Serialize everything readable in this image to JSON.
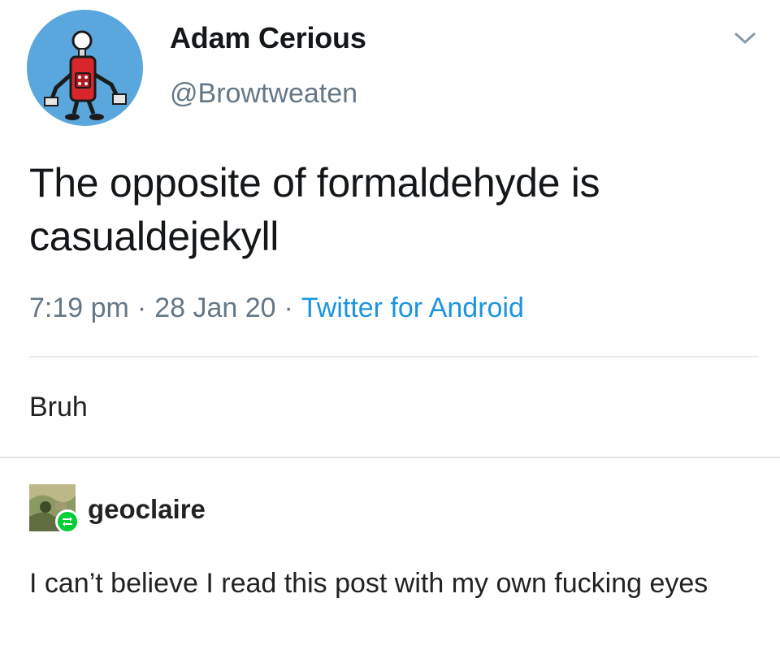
{
  "tweet": {
    "display_name": "Adam Cerious",
    "handle": "@Browtweaten",
    "text": "The opposite of formaldehyde is casualdejekyll",
    "time": "7:19 pm",
    "date": "28 Jan 20",
    "source": "Twitter for Android",
    "separator": "·",
    "avatar_icon": "robot-avatar",
    "menu_icon": "chevron-down-icon"
  },
  "post": {
    "caption": "Bruh"
  },
  "reblog": {
    "username": "geoclaire",
    "text": "I can’t believe I read this post with my own fucking eyes",
    "badge_icon": "reblog-icon"
  },
  "colors": {
    "avatar_bg": "#5aa7de",
    "source_link": "#1b95e0",
    "meta_gray": "#657786",
    "reblog_green": "#00cf35"
  }
}
